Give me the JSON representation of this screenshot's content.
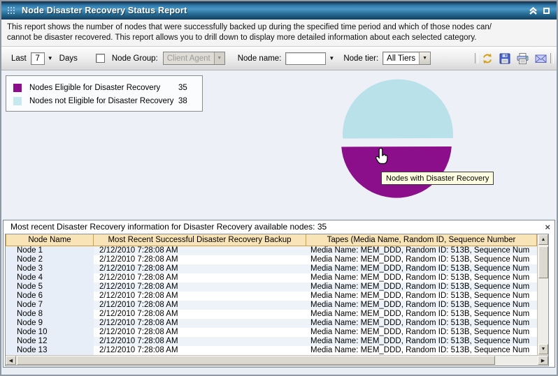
{
  "window": {
    "title": "Node Disaster Recovery Status Report",
    "controls": [
      {
        "name": "collapse-icon"
      },
      {
        "name": "restore-icon"
      }
    ]
  },
  "description": {
    "line1": "This report shows the number of nodes that were successfully backed up during the specified time period and which of those nodes can/",
    "line2": "cannot be disaster recovered. This report allows you to drill down to display more detailed information about each selected category."
  },
  "filters": {
    "last_label": "Last",
    "period_value": "7",
    "days_label": "Days",
    "node_group_label": "Node Group:",
    "node_group_value": "Client Agent",
    "node_group_checked": false,
    "node_name_label": "Node name:",
    "node_name_value": "",
    "node_tier_label": "Node tier:",
    "node_tier_value": "All Tiers"
  },
  "toolbar": {
    "icons": [
      "refresh-icon",
      "save-icon",
      "print-icon",
      "email-icon"
    ]
  },
  "legend": {
    "items": [
      {
        "label": "Nodes Eligible for Disaster Recovery",
        "value": "35",
        "color": "#8b0e8b"
      },
      {
        "label": "Nodes not Eligible for Disaster Recovery",
        "value": "38",
        "color": "#c6e9f0"
      }
    ]
  },
  "chart_data": {
    "type": "pie",
    "title": "",
    "slices": [
      {
        "label": "Nodes Eligible for Disaster Recovery",
        "value": 35,
        "color": "#8b0e8b",
        "exploded": true
      },
      {
        "label": "Nodes not Eligible for Disaster Recovery",
        "value": 38,
        "color": "#b9e1ea",
        "exploded": false
      }
    ],
    "legend_position": "top-left"
  },
  "tooltip": {
    "text": "Nodes with Disaster Recovery"
  },
  "panel": {
    "title": "Most recent Disaster Recovery information for Disaster Recovery available nodes: 35",
    "close_label": "×",
    "columns": [
      "Node Name",
      "Most Recent Successful Disaster Recovery Backup",
      "Tapes (Media Name, Random ID, Sequence Number"
    ],
    "rows": [
      {
        "name": "Node 1",
        "backup": "2/12/2010 7:28:08 AM",
        "tapes": "Media Name: MEM_DDD, Random ID: 513B, Sequence Num"
      },
      {
        "name": "Node 2",
        "backup": "2/12/2010 7:28:08 AM",
        "tapes": "Media Name: MEM_DDD, Random ID: 513B, Sequence Num"
      },
      {
        "name": "Node 3",
        "backup": "2/12/2010 7:28:08 AM",
        "tapes": "Media Name: MEM_DDD, Random ID: 513B, Sequence Num"
      },
      {
        "name": "Node 4",
        "backup": "2/12/2010 7:28:08 AM",
        "tapes": "Media Name: MEM_DDD, Random ID: 513B, Sequence Num"
      },
      {
        "name": "Node 5",
        "backup": "2/12/2010 7:28:08 AM",
        "tapes": "Media Name: MEM_DDD, Random ID: 513B, Sequence Num"
      },
      {
        "name": "Node 6",
        "backup": "2/12/2010 7:28:08 AM",
        "tapes": "Media Name: MEM_DDD, Random ID: 513B, Sequence Num"
      },
      {
        "name": "Node 7",
        "backup": "2/12/2010 7:28:08 AM",
        "tapes": "Media Name: MEM_DDD, Random ID: 513B, Sequence Num"
      },
      {
        "name": "Node 8",
        "backup": "2/12/2010 7:28:08 AM",
        "tapes": "Media Name: MEM_DDD, Random ID: 513B, Sequence Num"
      },
      {
        "name": "Node 9",
        "backup": "2/12/2010 7:28:08 AM",
        "tapes": "Media Name: MEM_DDD, Random ID: 513B, Sequence Num"
      },
      {
        "name": "Node 10",
        "backup": "2/12/2010 7:28:08 AM",
        "tapes": "Media Name: MEM_DDD, Random ID: 513B, Sequence Num"
      },
      {
        "name": "Node 12",
        "backup": "2/12/2010 7:28:08 AM",
        "tapes": "Media Name: MEM_DDD, Random ID: 513B, Sequence Num"
      },
      {
        "name": "Node 13",
        "backup": "2/12/2010 7:28:08 AM",
        "tapes": "Media Name: MEM_DDD, Random ID: 513B, Sequence Num"
      }
    ]
  }
}
